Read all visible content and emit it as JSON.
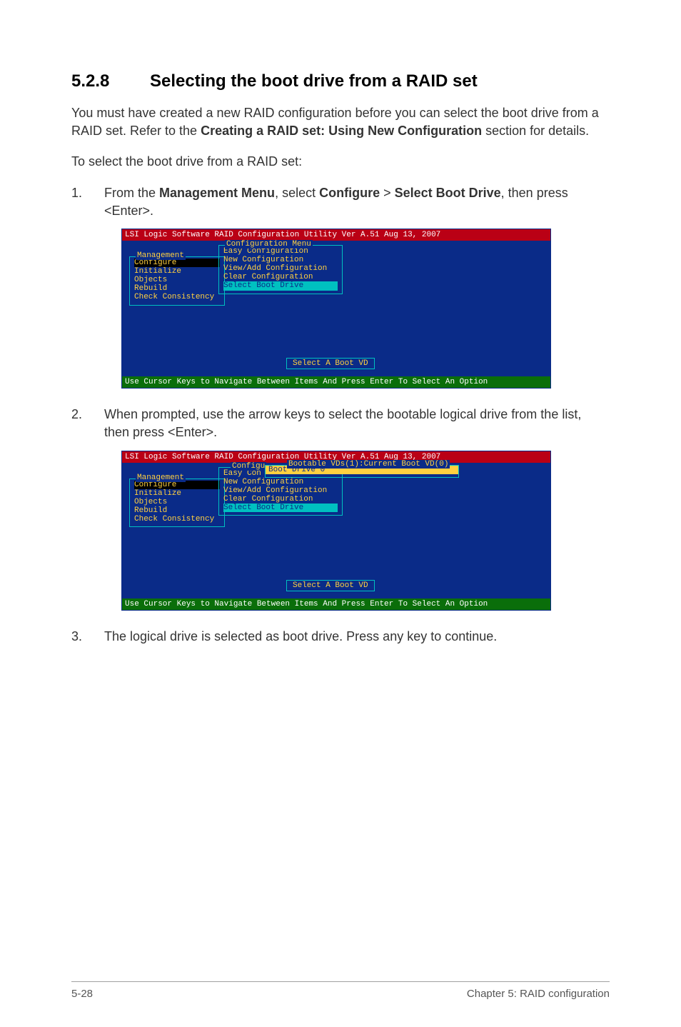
{
  "section": {
    "number": "5.2.8",
    "title": "Selecting the boot drive from a RAID set"
  },
  "intro": {
    "pre": "You must have created a new RAID configuration before you can select the boot drive from a RAID set. Refer to the ",
    "bold": "Creating a RAID set: Using New Configuration",
    "post": " section for details."
  },
  "lead": "To select the boot drive from a RAID set:",
  "steps": {
    "s1": {
      "num": "1.",
      "t1": "From the ",
      "b1": "Management Menu",
      "t2": ", select ",
      "b2": "Configure",
      "t3": " > ",
      "b3": "Select Boot Drive",
      "t4": ", then press <Enter>."
    },
    "s2": {
      "num": "2.",
      "text": "When prompted, use the arrow keys to select the bootable logical drive from the list, then press <Enter>."
    },
    "s3": {
      "num": "3.",
      "text": "The logical drive is selected as boot drive. Press any key to continue."
    }
  },
  "console1": {
    "top": "LSI Logic Software RAID Configuration Utility Ver A.51 Aug 13, 2007",
    "mgmt_title": "Management",
    "mgmt_items": [
      "Configure",
      "Initialize",
      "Objects",
      "Rebuild",
      "Check Consistency"
    ],
    "cfg_title": "Configuration Menu",
    "cfg_items": [
      "Easy Configuration",
      "New Configuration",
      "View/Add Configuration",
      "Clear Configuration",
      "Select Boot Drive"
    ],
    "center": "Select A Boot VD",
    "bottom": "Use Cursor Keys to Navigate Between Items And Press Enter To Select An Option"
  },
  "console2": {
    "top": "LSI Logic Software RAID Configuration Utility Ver A.51 Aug 13, 2007",
    "mgmt_title": "Management",
    "mgmt_items": [
      "Configure",
      "Initialize",
      "Objects",
      "Rebuild",
      "Check Consistency"
    ],
    "cfg_title_short": "Configu",
    "cfg_first": "Easy Con",
    "cfg_rest": [
      "New Configuration",
      "View/Add Configuration",
      "Clear Configuration",
      "Select Boot Drive"
    ],
    "boot_title": "Bootable VDs(1):Current Boot VD(0)",
    "boot_entry": "Boot Drive 0",
    "center": "Select A Boot VD",
    "bottom": "Use Cursor Keys to Navigate Between Items And Press Enter To Select An Option"
  },
  "footer": {
    "left": "5-28",
    "right": "Chapter 5: RAID configuration"
  }
}
